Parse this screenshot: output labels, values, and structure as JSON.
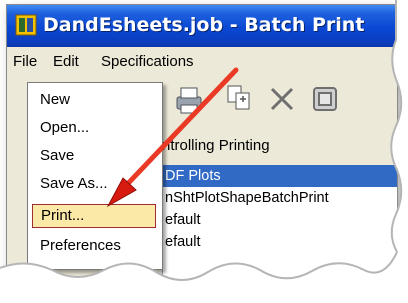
{
  "window": {
    "title": "DandEsheets.job - Batch Print",
    "icon": "microstation-icon"
  },
  "menubar": {
    "items": [
      {
        "label": "File",
        "mnemonic": "F"
      },
      {
        "label": "Edit",
        "mnemonic": "E"
      },
      {
        "label": "Specifications",
        "mnemonic": "i"
      }
    ]
  },
  "toolbar": {
    "icons": [
      "printer-icon",
      "copy-pages-icon",
      "delete-x-icon",
      "window-icon"
    ]
  },
  "main": {
    "group_label": "ntrolling Printing",
    "list_items": [
      {
        "label": "DF Plots",
        "selected": true
      },
      {
        "label": "nShtPlotShapeBatchPrint",
        "selected": false
      },
      {
        "label": "efault",
        "selected": false
      },
      {
        "label": "efault",
        "selected": false
      }
    ]
  },
  "file_menu": {
    "items": [
      {
        "label": "New"
      },
      {
        "label": "Open..."
      },
      {
        "label": "Save"
      },
      {
        "label": "Save As..."
      },
      {
        "label": "Print...",
        "highlighted": true
      },
      {
        "label": "Preferences"
      }
    ]
  },
  "colors": {
    "titlebar": "#0a48d4",
    "selection": "#316ac5",
    "menu_highlight": "#fbe9a7",
    "arrow": "#e8281a",
    "face": "#ece9d8"
  }
}
